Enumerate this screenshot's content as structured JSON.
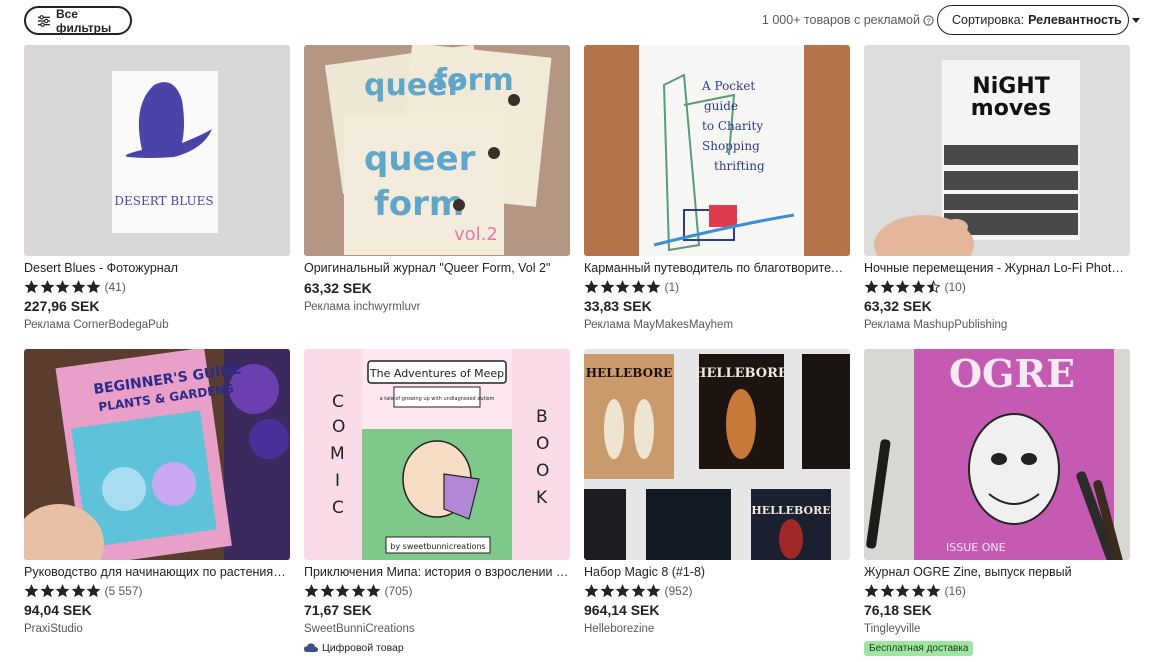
{
  "toolbar": {
    "filter_label": "Все фильтры",
    "results_text": "1 000+ товаров с рекламой",
    "sort_prefix": "Сортировка:",
    "sort_value": "Релевантность"
  },
  "colors": {
    "star": "#222222",
    "free_shipping_bg": "#9ee5a2",
    "text_muted": "#595959"
  },
  "listings": [
    {
      "title": "Desert Blues - Фотожурнал",
      "rating_count": "(41)",
      "price": "227,96 SEK",
      "seller": "Реклама CornerBodegaPub",
      "stars": 5,
      "badge": ""
    },
    {
      "title": "Оригинальный журнал \"Queer Form, Vol 2\"",
      "rating_count": "",
      "price": "63,32 SEK",
      "seller": "Реклама inchwyrmluvr",
      "stars": 0,
      "badge": ""
    },
    {
      "title": "Карманный путеводитель по благотворительным магазинам",
      "rating_count": "(1)",
      "price": "33,83 SEK",
      "seller": "Реклама MayMakesMayhem",
      "stars": 5,
      "badge": ""
    },
    {
      "title": "Ночные перемещения - Журнал Lo-Fi Photography",
      "rating_count": "(10)",
      "price": "63,32 SEK",
      "seller": "Реклама MashupPublishing",
      "stars": 4.5,
      "badge": ""
    },
    {
      "title": "Руководство для начинающих по растениям и садам",
      "rating_count": "(5 557)",
      "price": "94,04 SEK",
      "seller": "PraxiStudio",
      "stars": 5,
      "badge": ""
    },
    {
      "title": "Приключения Мипа: история о взрослении с аутизмом",
      "rating_count": "(705)",
      "price": "71,67 SEK",
      "seller": "SweetBunniCreations",
      "stars": 5,
      "badge": "Цифровой товар"
    },
    {
      "title": "Набор Magic 8 (#1-8)",
      "rating_count": "(952)",
      "price": "964,14 SEK",
      "seller": "Helleborezine",
      "stars": 5,
      "badge": ""
    },
    {
      "title": "Журнал OGRE Zine, выпуск первый",
      "rating_count": "(16)",
      "price": "76,18 SEK",
      "seller": "Tingleyville",
      "stars": 5,
      "badge": "Бесплатная доставка"
    }
  ],
  "thumb_text": {
    "desert": "DESERT BLUES",
    "queer_1": "queer",
    "queer_2": "form",
    "queer_3": "vol.2",
    "pocket": "A Pocket guide to Charity Shopping n thrifting",
    "night_1": "NiGHT",
    "night_2": "moves",
    "beginner": "BEGINNER'S GUIDE",
    "beginner_2": "PLANTS & GARDENS",
    "meep_title": "The Adventures of Meep",
    "meep_sub": "a tale of growing up with undiagnosed autism",
    "meep_by": "by sweetbunnicreations",
    "comic": "COMIC",
    "book": "BOOK",
    "hellebore": "HELLEBORE",
    "ogre": "OGRE",
    "ogre_issue": "ISSUE ONE"
  }
}
